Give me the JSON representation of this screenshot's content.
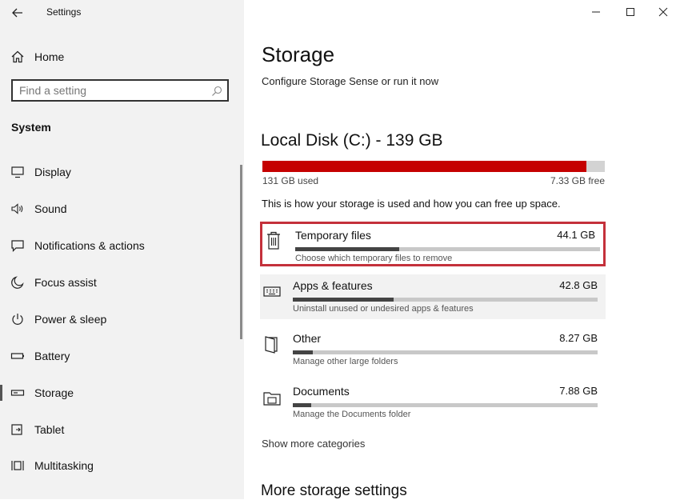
{
  "window": {
    "title": "Settings"
  },
  "sidebar": {
    "home_label": "Home",
    "search_placeholder": "Find a setting",
    "section_label": "System",
    "items": [
      {
        "label": "Display",
        "icon": "monitor-icon"
      },
      {
        "label": "Sound",
        "icon": "speaker-icon"
      },
      {
        "label": "Notifications & actions",
        "icon": "message-icon"
      },
      {
        "label": "Focus assist",
        "icon": "moon-icon"
      },
      {
        "label": "Power & sleep",
        "icon": "power-icon"
      },
      {
        "label": "Battery",
        "icon": "battery-icon"
      },
      {
        "label": "Storage",
        "icon": "drive-icon",
        "active": true
      },
      {
        "label": "Tablet",
        "icon": "tablet-icon"
      },
      {
        "label": "Multitasking",
        "icon": "multitasking-icon"
      }
    ]
  },
  "main": {
    "title": "Storage",
    "subtitle": "Configure Storage Sense or run it now",
    "disk": {
      "title": "Local Disk (C:) - 139 GB",
      "used_label": "131 GB used",
      "free_label": "7.33 GB free",
      "used_fraction": 0.947
    },
    "info_text": "This is how your storage is used and how you can free up space.",
    "categories": [
      {
        "name": "Temporary files",
        "size": "44.1 GB",
        "desc": "Choose which temporary files to remove",
        "fraction": 0.34,
        "icon": "trash-icon"
      },
      {
        "name": "Apps & features",
        "size": "42.8 GB",
        "desc": "Uninstall unused or undesired apps & features",
        "fraction": 0.33,
        "icon": "keyboard-icon"
      },
      {
        "name": "Other",
        "size": "8.27 GB",
        "desc": "Manage other large folders",
        "fraction": 0.065,
        "icon": "file-icon"
      },
      {
        "name": "Documents",
        "size": "7.88 GB",
        "desc": "Manage the Documents folder",
        "fraction": 0.06,
        "icon": "folder-icon"
      }
    ],
    "show_more": "Show more categories",
    "more_settings_title": "More storage settings"
  },
  "colors": {
    "accent_red": "#c50000",
    "highlight_border": "#c4313b"
  }
}
